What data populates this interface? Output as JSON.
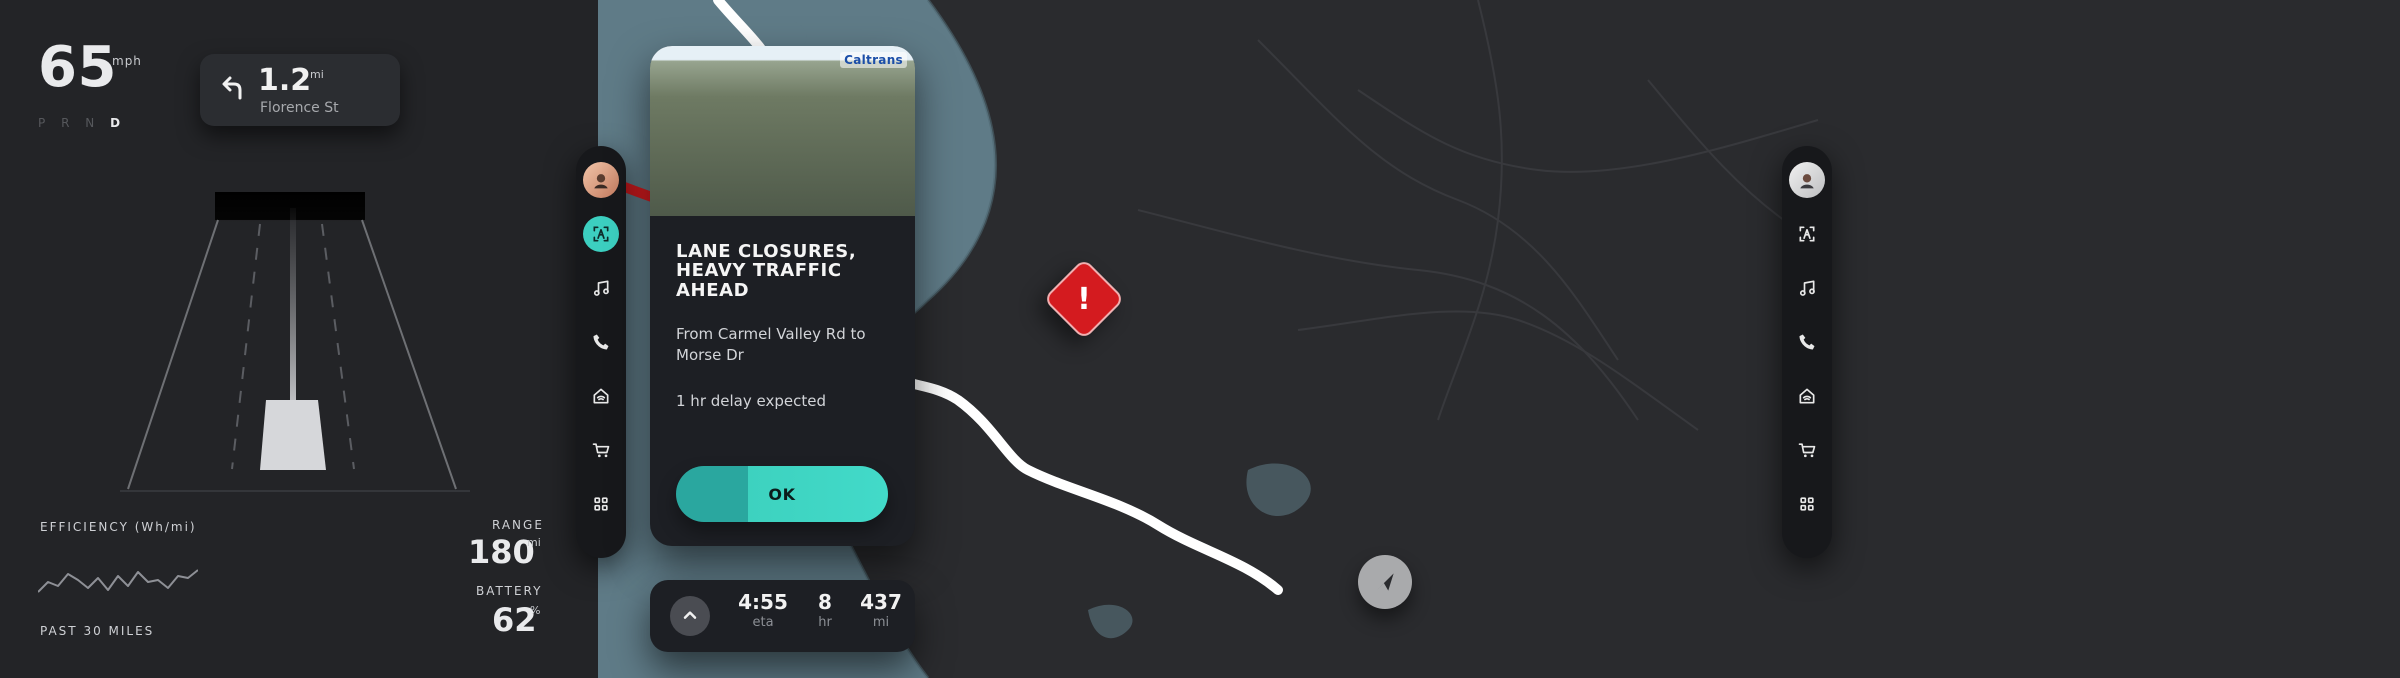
{
  "left_dash": {
    "speed": "65",
    "speed_unit": "mph",
    "gear": {
      "p": "P",
      "r": "R",
      "n": "N",
      "d": "D",
      "active": "D"
    },
    "next_turn": {
      "distance": "1.2",
      "unit": "mi",
      "street": "Florence St"
    },
    "efficiency_label": "EFFICIENCY (Wh/mi)",
    "past_label": "PAST 30 MILES",
    "range_label": "RANGE",
    "range_value": "180",
    "range_unit": "mi",
    "battery_label": "BATTERY",
    "battery_value": "62",
    "battery_unit": "%"
  },
  "alert": {
    "camera_brand": "Caltrans",
    "title": "LANE CLOSURES, HEAVY TRAFFIC AHEAD",
    "body": "From Carmel Valley Rd to Morse Dr",
    "delay": "1 hr delay expected",
    "ok_label": "OK"
  },
  "eta": {
    "time": {
      "value": "4:55",
      "label": "eta"
    },
    "hours": {
      "value": "8",
      "label": "hr"
    },
    "miles": {
      "value": "437",
      "label": "mi"
    }
  },
  "docks": {
    "left": [
      {
        "name": "profile-avatar",
        "icon": "avatar"
      },
      {
        "name": "assistant",
        "icon": "assistant-icon",
        "active": true
      },
      {
        "name": "music",
        "icon": "music-icon"
      },
      {
        "name": "phone",
        "icon": "phone-icon"
      },
      {
        "name": "home",
        "icon": "home-icon"
      },
      {
        "name": "shopping",
        "icon": "cart-icon"
      },
      {
        "name": "apps",
        "icon": "grid-icon"
      }
    ],
    "right": [
      {
        "name": "profile-avatar",
        "icon": "avatar"
      },
      {
        "name": "assistant",
        "icon": "assistant-icon",
        "active": false
      },
      {
        "name": "music",
        "icon": "music-icon"
      },
      {
        "name": "phone",
        "icon": "phone-icon"
      },
      {
        "name": "home",
        "icon": "home-icon"
      },
      {
        "name": "shopping",
        "icon": "cart-icon"
      },
      {
        "name": "apps",
        "icon": "grid-icon"
      }
    ]
  },
  "colors": {
    "accent": "#3ccfc0",
    "alert": "#d41b1f",
    "sea": "#5f7b87",
    "land": "#2a2b2e"
  }
}
